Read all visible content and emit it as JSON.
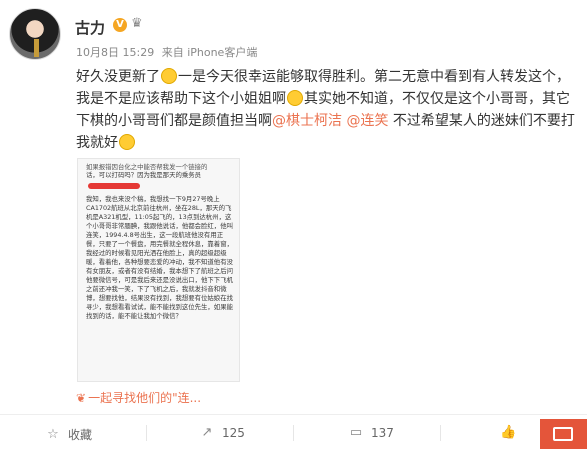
{
  "user": {
    "name": "古力",
    "verified_badge": "V",
    "member_icon": "crown-icon",
    "time": "10月8日 15:29",
    "source": "来自 iPhone客户端"
  },
  "post": {
    "text_1": "好久没更新了",
    "text_2": "一是今天很幸运能够取得胜利。第二无意中看到有人转发这个，我是不是应该帮助下这个小姐姐啊",
    "text_3": "其实她不知道，不仅仅是这个小哥哥，其它下棋的小哥哥们都是颜值担当啊",
    "mention_1": "@棋士柯洁",
    "mention_2": "@连笑",
    "text_4": " 不过希望某人的迷妹们不要打我就好"
  },
  "image": {
    "header_line_1": "如果报错因台化之中能否帮我发一个链接的",
    "header_line_2": "话，可以打码吗？因为我是那天的乘务员",
    "body": "我知，我也来没个稿，我想找一下9月27号晚上CA1702航班从北京前往杭州，坐在28L，那天的飞机是A321机型，11:05起飞的，13点到达杭州，这个小哥哥非常腼腆，我跟他说话，他都会脸红，他叫连笑，1994.4.8号出生，这一段航班他没有用正餐，只要了一个餐盘，用完餐就全程休息，靠着窗，我经过的时候看见阳光洒在他脸上，真的超级超级暖，看着他，各种想要恋爱的冲动，我不知道他有没有女朋友，或者有没有结婚，我本想下了航班之后问他要微信号，可是我后来还是没说出口，他下下飞机之前还冲我一笑，下了飞机之后，我就发抖音和微博，想要找他，结果没有找到，我想要有位姑娘在找寻少，我想看看试试，能不能找到这位先生，如果能找到的话，能不能让我加个微信？"
  },
  "caption": {
    "text": "一起寻找他们的\"连..."
  },
  "actions": {
    "favorite": "收藏",
    "forward_count": "125",
    "comment_count": "137"
  }
}
